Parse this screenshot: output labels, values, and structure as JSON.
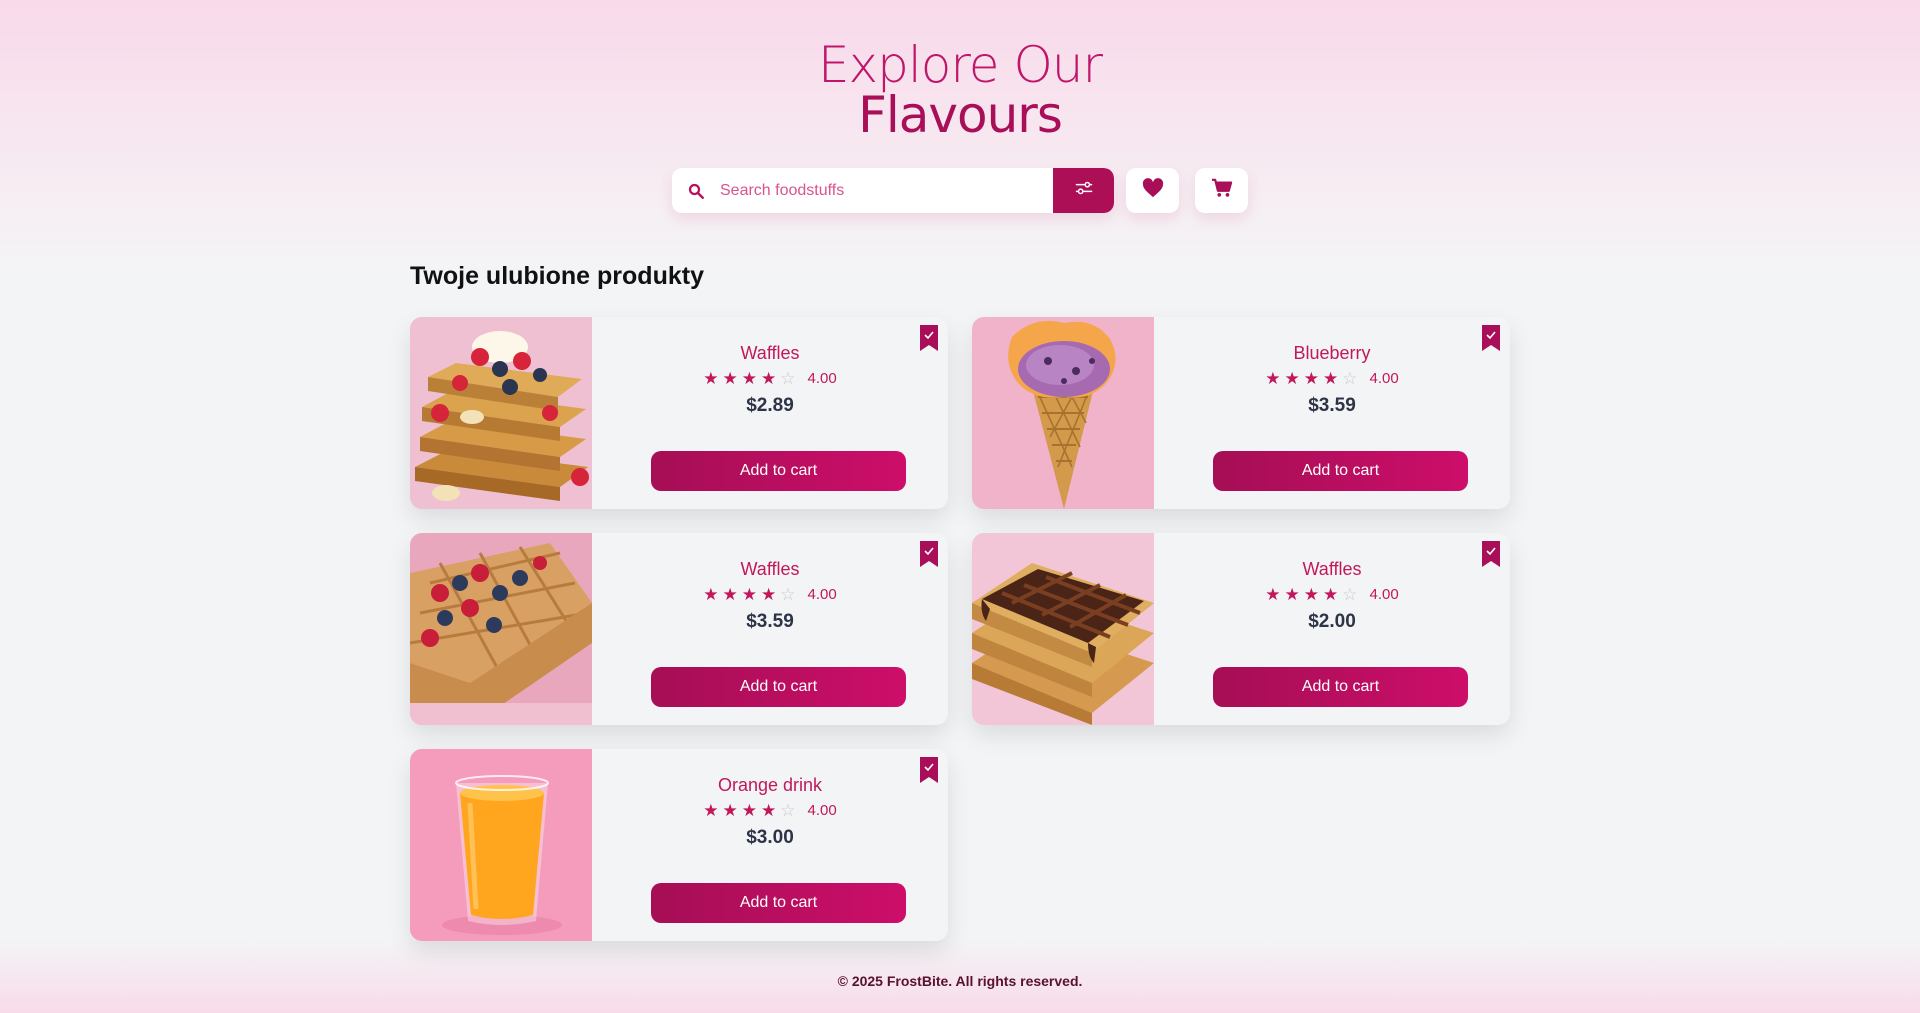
{
  "hero": {
    "line1": "Explore Our",
    "line2": "Flavours"
  },
  "search": {
    "placeholder": "Search foodstuffs"
  },
  "section": {
    "title": "Twoje ulubione produkty"
  },
  "products": [
    {
      "name": "Waffles",
      "rating": "4.00",
      "stars": 4,
      "price": "$2.89",
      "button": "Add to cart"
    },
    {
      "name": "Blueberry",
      "rating": "4.00",
      "stars": 4,
      "price": "$3.59",
      "button": "Add to cart"
    },
    {
      "name": "Waffles",
      "rating": "4.00",
      "stars": 4,
      "price": "$3.59",
      "button": "Add to cart"
    },
    {
      "name": "Waffles",
      "rating": "4.00",
      "stars": 4,
      "price": "$2.00",
      "button": "Add to cart"
    },
    {
      "name": "Orange drink",
      "rating": "4.00",
      "stars": 4,
      "price": "$3.00",
      "button": "Add to cart"
    }
  ],
  "footer": {
    "text": "© 2025 FrostBite. All rights reserved."
  },
  "colors": {
    "accent": "#c2185b",
    "accent_dark": "#a50e55",
    "background": "#f3f4f6"
  },
  "icons": {
    "search": "search-icon",
    "filter": "sliders-icon",
    "favorites": "heart-icon",
    "cart": "cart-icon",
    "saved": "bookmark-check-icon"
  }
}
